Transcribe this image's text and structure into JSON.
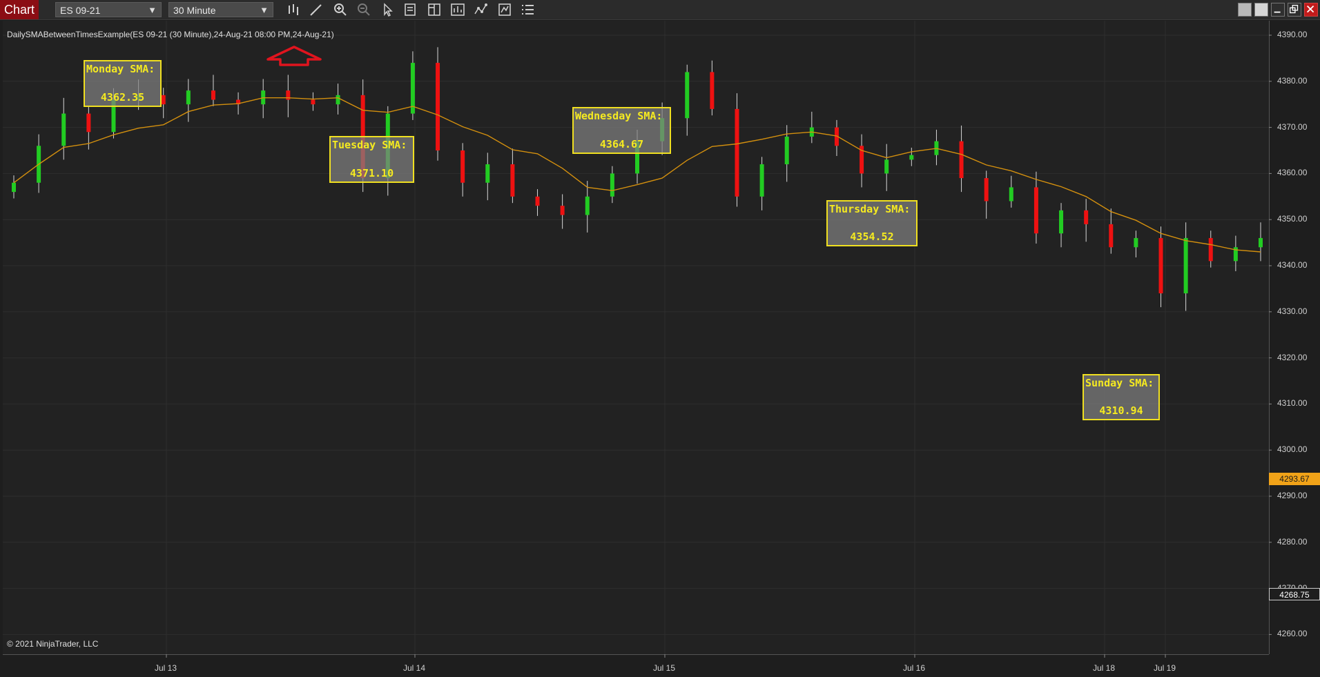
{
  "window": {
    "app_tab": "Chart",
    "instrument": "ES 09-21",
    "interval": "30 Minute"
  },
  "toolbar": {
    "tools": [
      "bar-type-icon",
      "drawing-tool-icon",
      "zoom-in-icon",
      "zoom-out-icon",
      "pointer-icon",
      "data-box-icon",
      "templates-icon",
      "strategies-icon",
      "indicators-icon",
      "properties-icon",
      "list-icon"
    ]
  },
  "chart": {
    "indicator_title": "DailySMABetweenTimesExample(ES 09-21 (30 Minute),24-Aug-21 08:00 PM,24-Aug-21)",
    "copyright": "© 2021 NinjaTrader, LLC",
    "price_labels": [
      "4390.00",
      "4380.00",
      "4370.00",
      "4360.00",
      "4350.00",
      "4340.00",
      "4330.00",
      "4320.00",
      "4310.00",
      "4300.00",
      "4290.00",
      "4280.00",
      "4270.00",
      "4260.00"
    ],
    "time_labels": [
      "Jul 13",
      "Jul 14",
      "Jul 15",
      "Jul 16",
      "Jul 18",
      "Jul 19"
    ],
    "sma_last": "4293.67",
    "price_last": "4268.75",
    "sma_boxes": [
      {
        "label": "Monday SMA:",
        "value": "4362.35"
      },
      {
        "label": "Tuesday SMA:",
        "value": "4371.10"
      },
      {
        "label": "Wednesday SMA:",
        "value": "4364.67"
      },
      {
        "label": "Thursday SMA:",
        "value": "4354.52"
      },
      {
        "label": "Sunday SMA:",
        "value": "4310.94"
      }
    ],
    "colors": {
      "up_candle": "#22cc22",
      "down_candle": "#ee1111",
      "sma_line": "#d4900e",
      "box_border": "#f0e020",
      "arrow": "#e0141e"
    }
  },
  "chart_data": {
    "type": "line",
    "series": [
      {
        "x": [
          0,
          6,
          12,
          18,
          24,
          30,
          36,
          42,
          48,
          54,
          60,
          66,
          72,
          78,
          84,
          90,
          96,
          102,
          108,
          114,
          120,
          126,
          132,
          138,
          144,
          150,
          156,
          162,
          168,
          174,
          180,
          186,
          192,
          198,
          204,
          210,
          216,
          222,
          228,
          234,
          240,
          246,
          252,
          258,
          264,
          270,
          276,
          282,
          288,
          294,
          300
        ],
        "values": [
          4358,
          4366,
          4373,
          4369,
          4376,
          4377,
          4375,
          4378,
          4376,
          4375,
          4378,
          4376,
          4375,
          4377,
          4359,
          4373,
          4384,
          4365,
          4358,
          4362,
          4355,
          4353,
          4351,
          4355,
          4360,
          4367,
          4372,
          4382,
          4374,
          4355,
          4362,
          4368,
          4370,
          4366,
          4360,
          4363,
          4364,
          4367,
          4359,
          4354,
          4357,
          4347,
          4352,
          4349,
          4344,
          4346,
          4334,
          4346,
          4341,
          4344,
          4346
        ]
      }
    ],
    "ylim": [
      4258,
      4392
    ]
  }
}
